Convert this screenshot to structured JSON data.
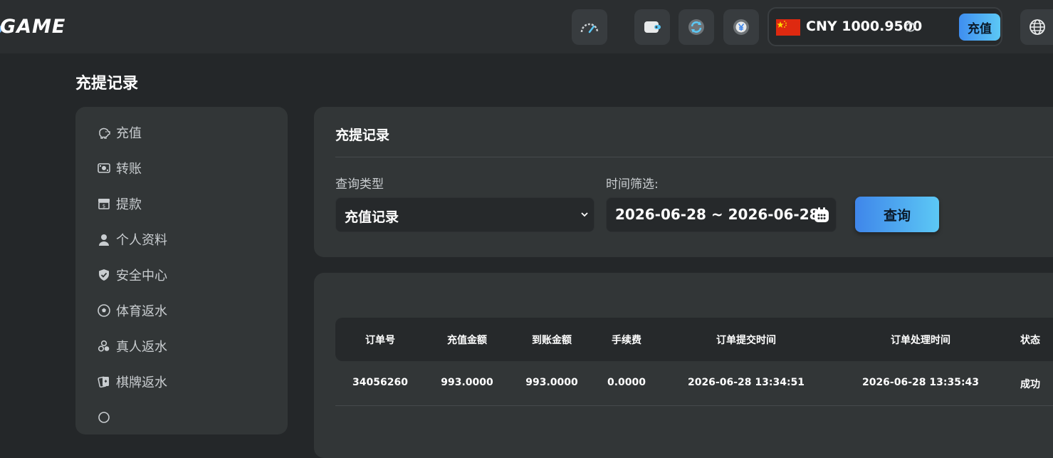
{
  "header": {
    "logo": "GAME",
    "balance": "CNY 1000.9500",
    "deposit_label": "充值",
    "icons": [
      "speedometer-icon",
      "wallet-icon",
      "refresh-exchange-icon",
      "yen-coin-icon",
      "china-flag-icon",
      "refresh-icon",
      "globe-icon"
    ]
  },
  "page_title": "充提记录",
  "sidebar": {
    "items": [
      {
        "label": "充值",
        "icon": "piggy-bank-icon"
      },
      {
        "label": "转账",
        "icon": "cash-icon"
      },
      {
        "label": "提款",
        "icon": "withdraw-icon"
      },
      {
        "label": "个人资料",
        "icon": "user-icon"
      },
      {
        "label": "安全中心",
        "icon": "shield-icon"
      },
      {
        "label": "体育返水",
        "icon": "soccer-ball-icon"
      },
      {
        "label": "真人返水",
        "icon": "chips-icon"
      },
      {
        "label": "棋牌返水",
        "icon": "cards-icon"
      }
    ]
  },
  "filter": {
    "title": "充提记录",
    "type_label": "查询类型",
    "type_value": "充值记录",
    "date_label": "时间筛选:",
    "date_value": "2026-06-28 ~ 2026-06-28",
    "query_label": "查询"
  },
  "table": {
    "headers": [
      "订单号",
      "充值金额",
      "到账金额",
      "手续费",
      "订单提交时间",
      "订单处理时间",
      "状态"
    ],
    "rows": [
      [
        "34056260",
        "993.0000",
        "993.0000",
        "0.0000",
        "2026-06-28 13:34:51",
        "2026-06-28 13:35:43",
        "成功"
      ]
    ]
  },
  "colors": {
    "background": "#242729",
    "topbar": "#2b2e30",
    "panel": "#323637",
    "accent_from": "#3f86ea",
    "accent_to": "#5cc8f5",
    "flag_red": "#de2910"
  }
}
